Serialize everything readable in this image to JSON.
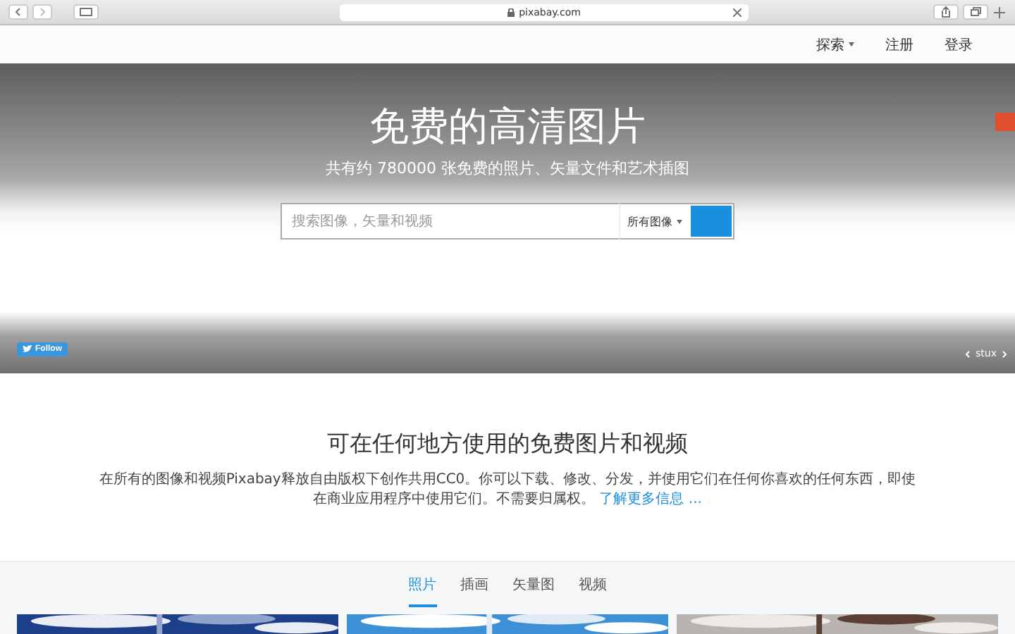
{
  "browser": {
    "url": "pixabay.com"
  },
  "nav": {
    "items": [
      {
        "label": "探索",
        "dropdown": true
      },
      {
        "label": "注册",
        "dropdown": false
      },
      {
        "label": "登录",
        "dropdown": false
      }
    ]
  },
  "hero": {
    "title": "免费的高清图片",
    "subtitle": "共有约 780000 张免费的照片、矢量文件和艺术插图",
    "search": {
      "placeholder": "搜索图像，矢量和视频",
      "filter": "所有图像"
    },
    "follow": "Follow",
    "credit": "stux"
  },
  "intro": {
    "heading": "可在任何地方使用的免费图片和视频",
    "text": "在所有的图像和视频Pixabay释放自由版权下创作共用CC0。你可以下载、修改、分发，并使用它们在任何你喜欢的任何东西，即使在商业应用程序中使用它们。不需要归属权。",
    "link": "了解更多信息 ..."
  },
  "tabs": [
    {
      "label": "照片",
      "selected": true
    },
    {
      "label": "插画",
      "selected": false
    },
    {
      "label": "矢量图",
      "selected": false
    },
    {
      "label": "视频",
      "selected": false
    }
  ]
}
